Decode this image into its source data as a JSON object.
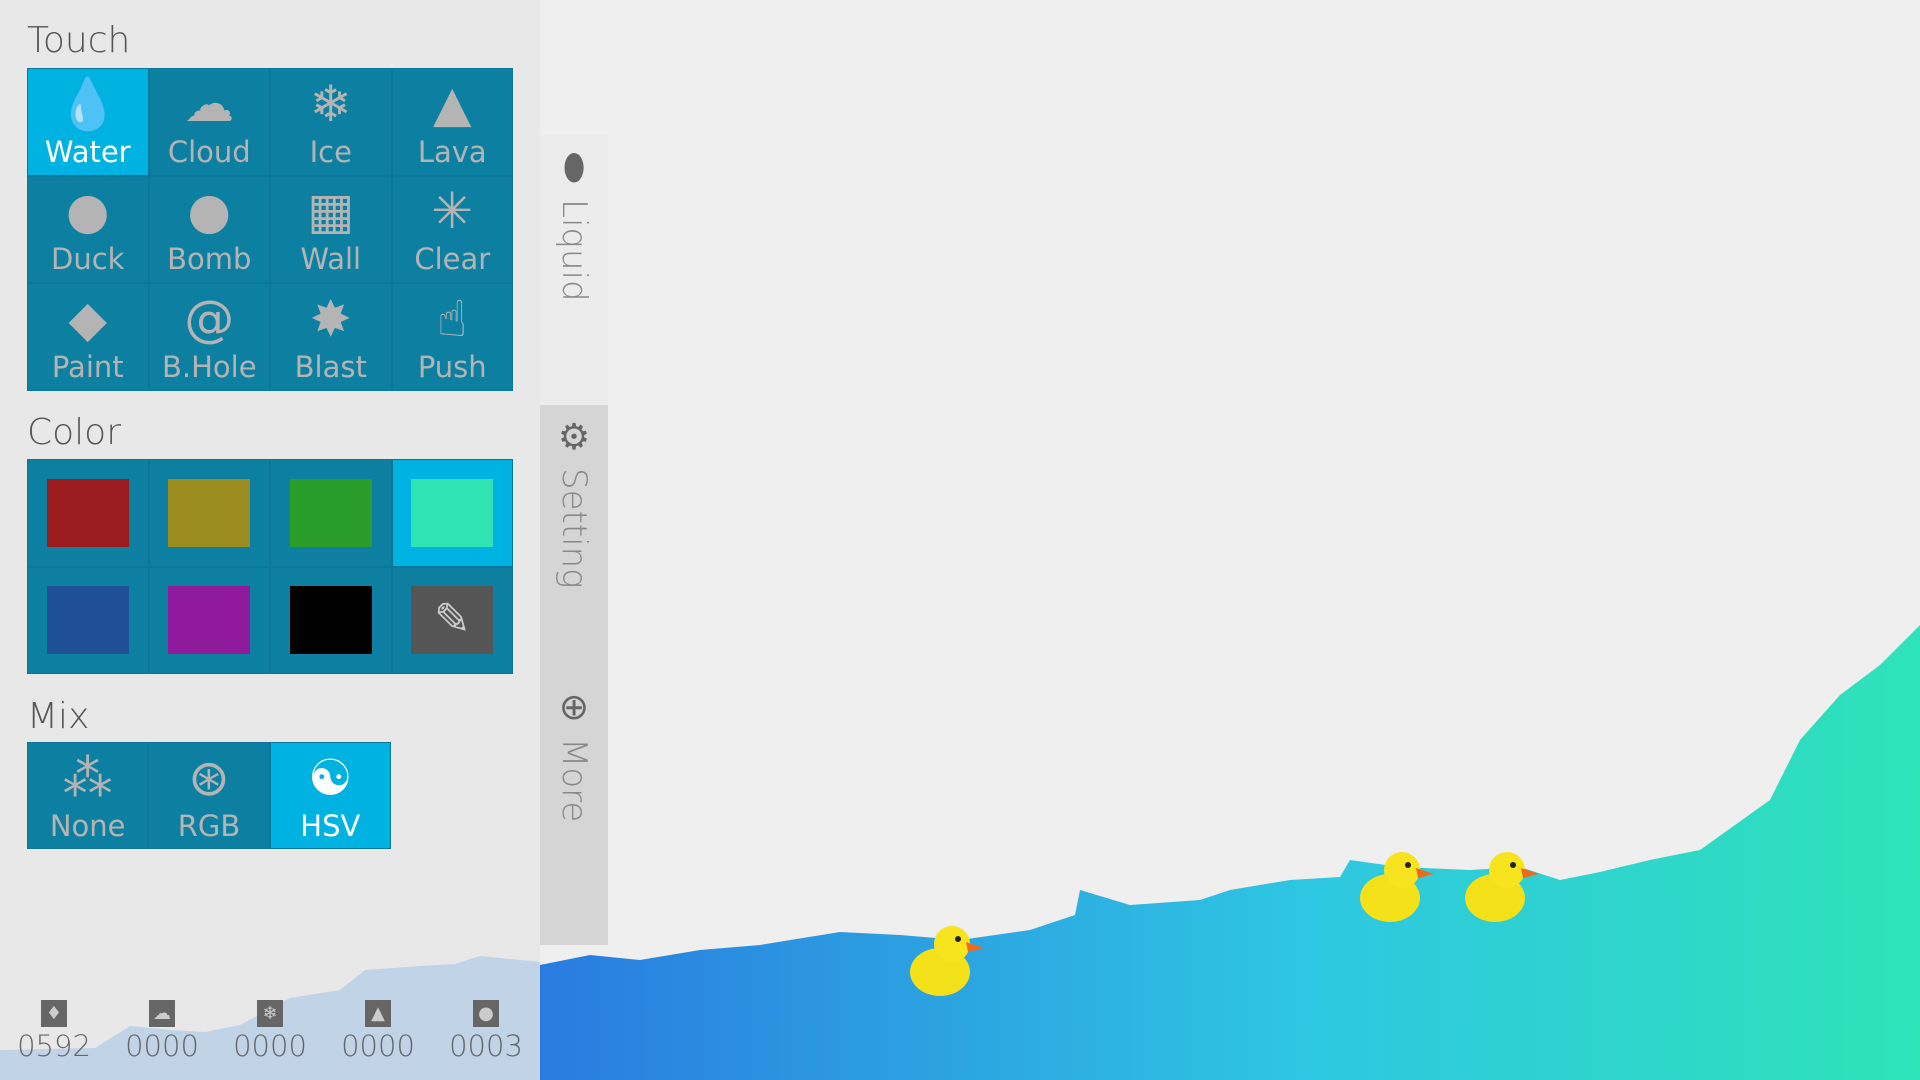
{
  "touch": {
    "title": "Touch",
    "items": [
      {
        "label": "Water",
        "icon": "water-drop-icon",
        "glyph": "💧",
        "selected": true
      },
      {
        "label": "Cloud",
        "icon": "cloud-icon",
        "glyph": "☁"
      },
      {
        "label": "Ice",
        "icon": "snowflake-icon",
        "glyph": "❄"
      },
      {
        "label": "Lava",
        "icon": "volcano-icon",
        "glyph": "▲"
      },
      {
        "label": "Duck",
        "icon": "duck-icon",
        "glyph": "●"
      },
      {
        "label": "Bomb",
        "icon": "bomb-icon",
        "glyph": "●"
      },
      {
        "label": "Wall",
        "icon": "brick-wall-icon",
        "glyph": "▦"
      },
      {
        "label": "Clear",
        "icon": "clear-burst-icon",
        "glyph": "✳"
      },
      {
        "label": "Paint",
        "icon": "paint-bucket-icon",
        "glyph": "◆"
      },
      {
        "label": "B.Hole",
        "icon": "black-hole-spiral-icon",
        "glyph": "@"
      },
      {
        "label": "Blast",
        "icon": "blast-icon",
        "glyph": "✸"
      },
      {
        "label": "Push",
        "icon": "pointing-hand-icon",
        "glyph": "☝"
      }
    ]
  },
  "color": {
    "title": "Color",
    "swatches": [
      "#9b1b1e",
      "#9b8c20",
      "#2a9c2a",
      "#2fe3b3",
      "#1f4f97",
      "#8f1a9c",
      "#000000"
    ],
    "selected": 3,
    "eyedropper_icon": "eyedropper-icon"
  },
  "mix": {
    "title": "Mix",
    "items": [
      {
        "label": "None",
        "icon": "three-circles-icon",
        "glyph": "⁂"
      },
      {
        "label": "RGB",
        "icon": "venn-circles-icon",
        "glyph": "⊛"
      },
      {
        "label": "HSV",
        "icon": "swirl-circle-icon",
        "glyph": "☯",
        "selected": true
      }
    ]
  },
  "stats": [
    {
      "icon": "water-drop-icon",
      "glyph": "♦",
      "value": "0592"
    },
    {
      "icon": "cloud-icon",
      "glyph": "☁",
      "value": "0000"
    },
    {
      "icon": "snowflake-icon",
      "glyph": "❄",
      "value": "0000"
    },
    {
      "icon": "volcano-icon",
      "glyph": "▲",
      "value": "0000"
    },
    {
      "icon": "duck-icon",
      "glyph": "●",
      "value": "0003"
    }
  ],
  "tabs": [
    {
      "label": "Liquid",
      "icon": "drop-icon",
      "glyph": "⬮"
    },
    {
      "label": "Setting",
      "icon": "gear-icon",
      "glyph": "⚙"
    },
    {
      "label": "More",
      "icon": "plus-circle-icon",
      "glyph": "⊕"
    }
  ],
  "colors": {
    "tile": "#0d80a2",
    "selected": "#00b2e2",
    "water_left": "#2a7be0",
    "water_right": "#2ee3b8"
  }
}
